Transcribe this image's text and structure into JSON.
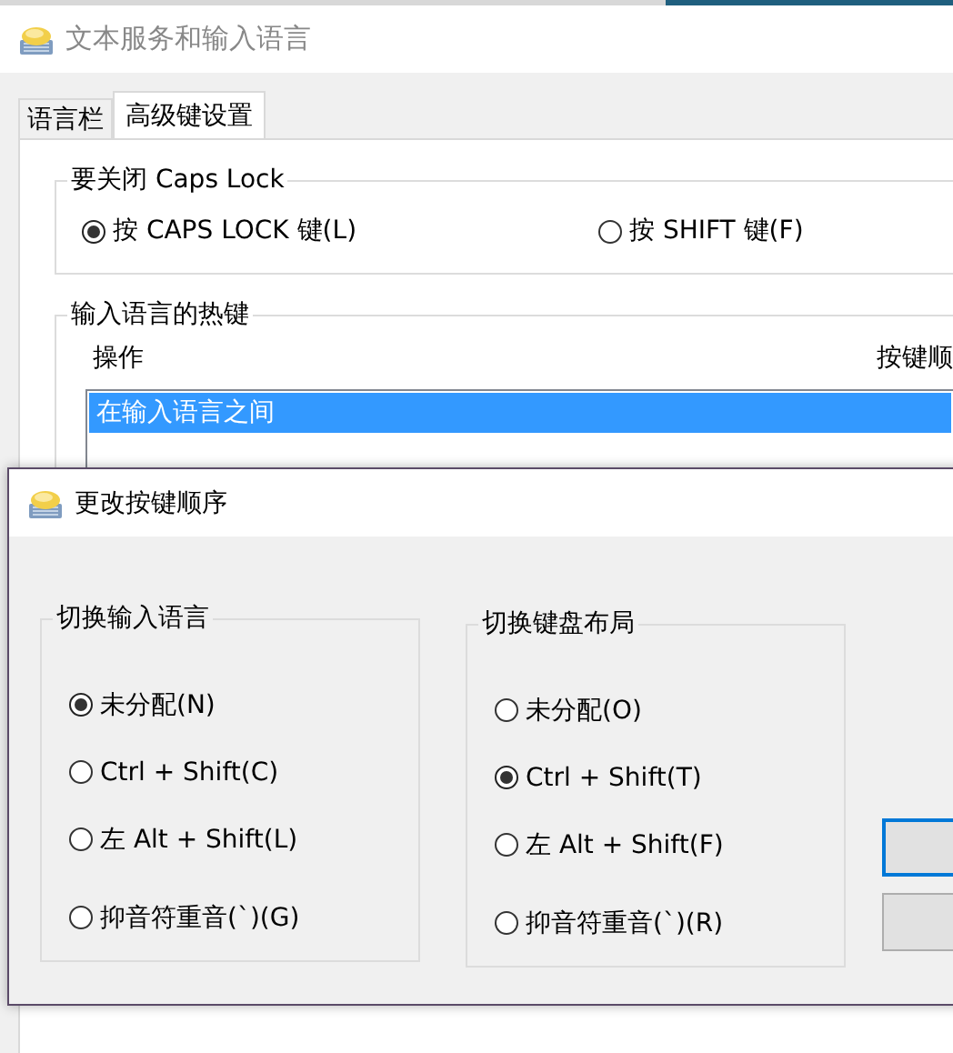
{
  "window": {
    "title": "文本服务和输入语言"
  },
  "tabs": [
    {
      "label": "语言栏",
      "selected": false
    },
    {
      "label": "高级键设置",
      "selected": true
    }
  ],
  "caps_lock_group": {
    "title": "要关闭 Caps Lock",
    "options": [
      {
        "label": "按 CAPS LOCK 键(L)",
        "selected": true
      },
      {
        "label": "按 SHIFT 键(F)",
        "selected": false
      }
    ]
  },
  "hotkeys_group": {
    "title": "输入语言的热键",
    "columns": [
      "操作",
      "按键顺"
    ],
    "rows": [
      {
        "action": "在输入语言之间",
        "selected": true
      }
    ]
  },
  "dialog": {
    "title": "更改按键顺序",
    "groups": [
      {
        "title": "切换输入语言",
        "options": [
          {
            "label": "未分配(N)",
            "selected": true
          },
          {
            "label": "Ctrl + Shift(C)",
            "selected": false
          },
          {
            "label": "左 Alt + Shift(L)",
            "selected": false
          },
          {
            "label": "抑音符重音(`)(G)",
            "selected": false
          }
        ]
      },
      {
        "title": "切换键盘布局",
        "options": [
          {
            "label": "未分配(O)",
            "selected": false
          },
          {
            "label": "Ctrl + Shift(T)",
            "selected": true
          },
          {
            "label": "左 Alt + Shift(F)",
            "selected": false
          },
          {
            "label": "抑音符重音(`)(R)",
            "selected": false
          }
        ]
      }
    ],
    "buttons": [
      {
        "default": true
      },
      {
        "default": false
      }
    ]
  }
}
